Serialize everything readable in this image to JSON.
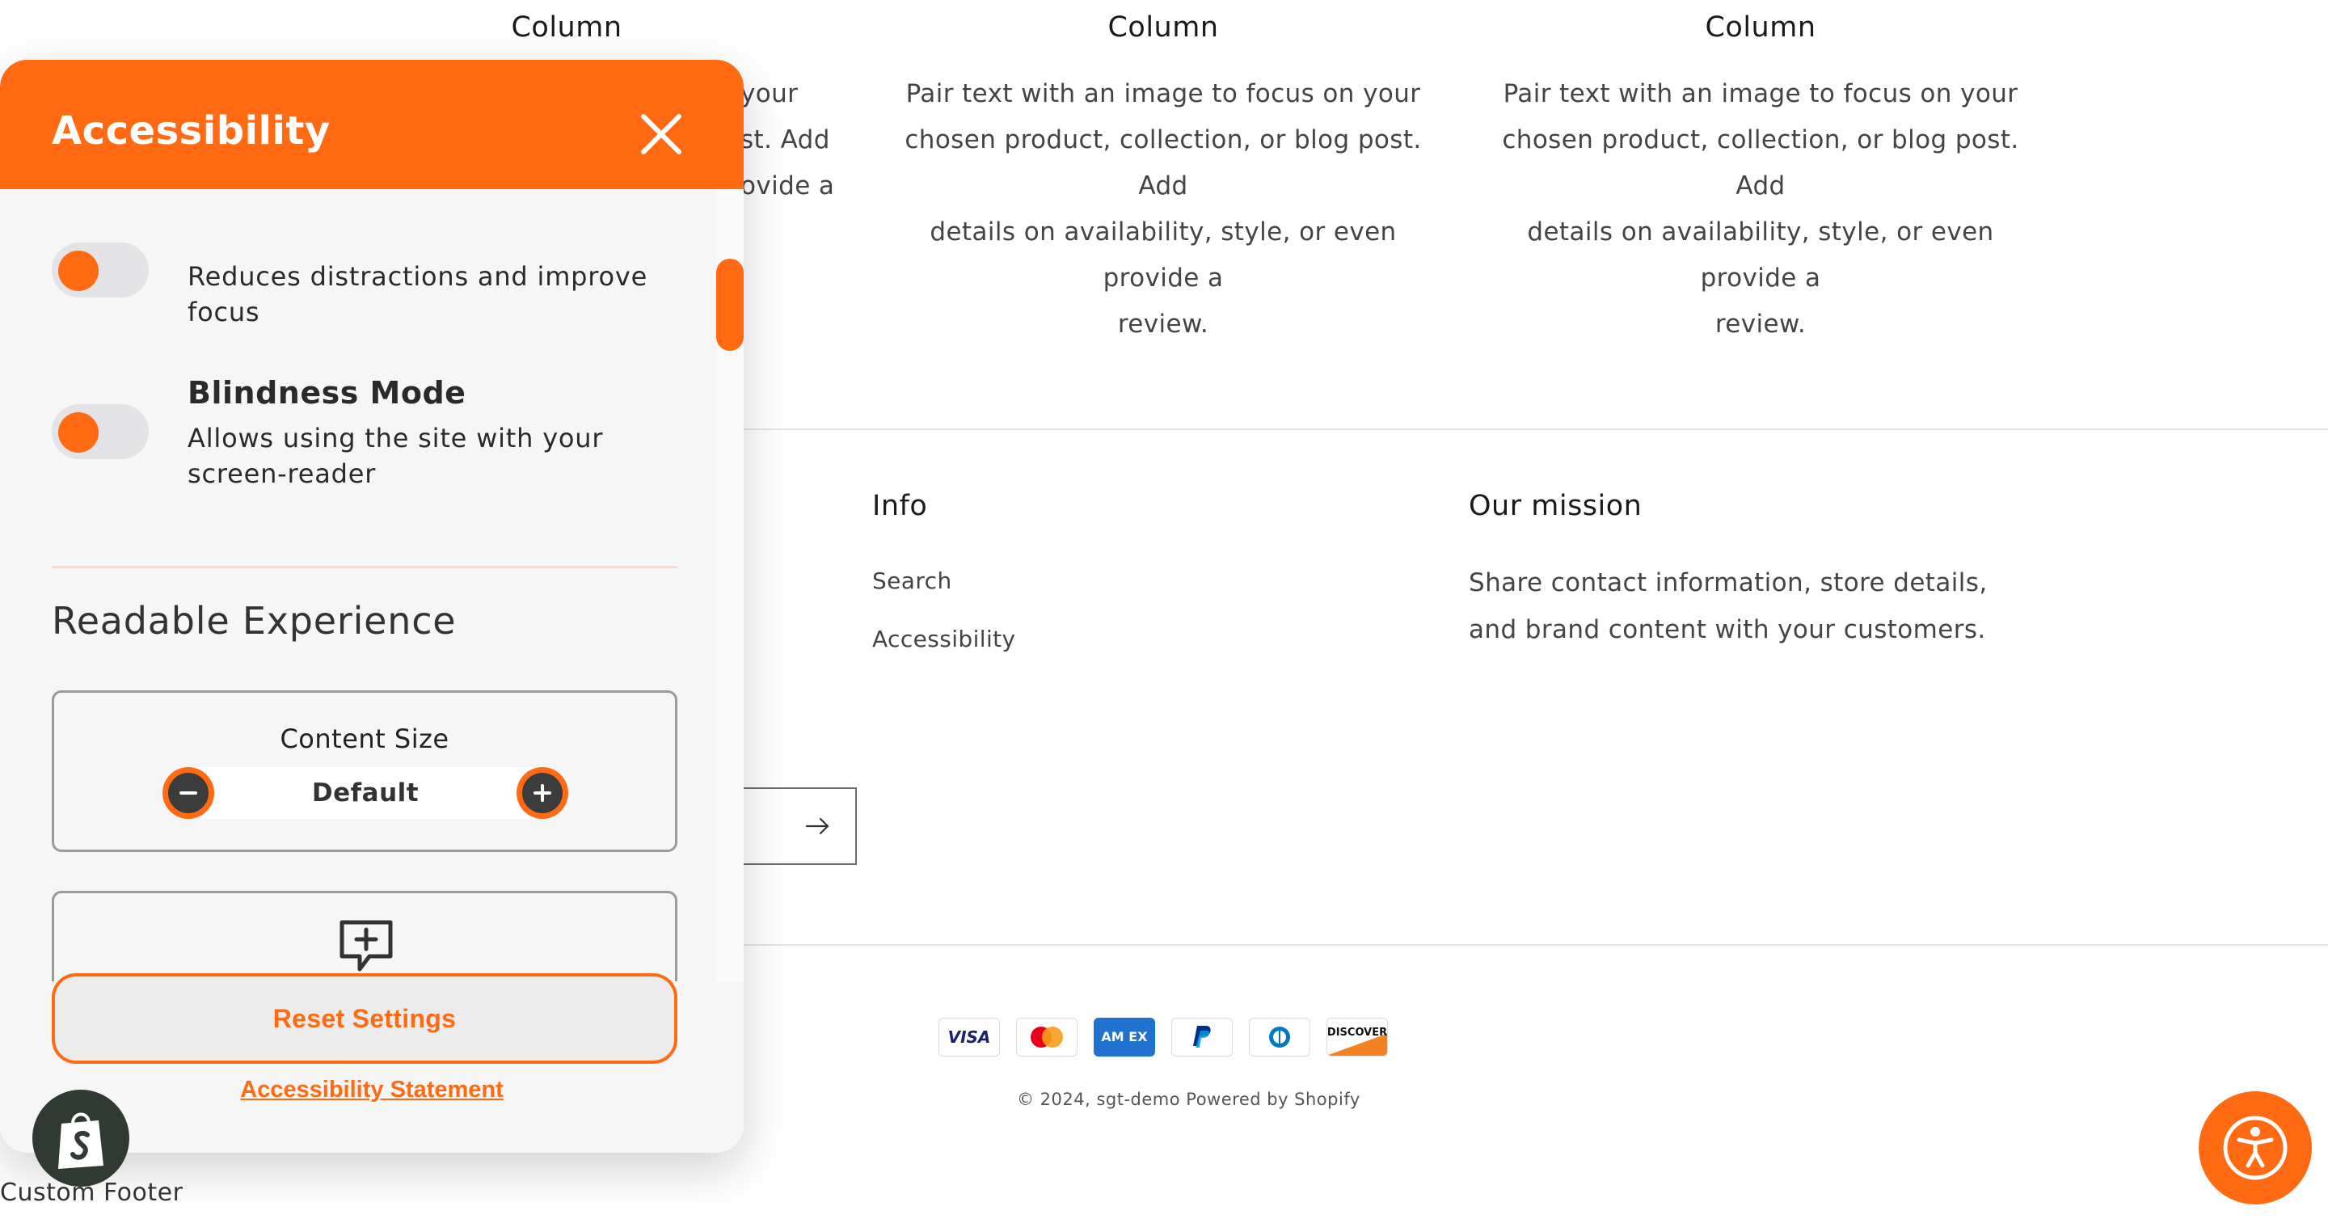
{
  "columns": [
    {
      "title": "Column",
      "text_fragment": [
        "your",
        "st. Add",
        "ovide a"
      ]
    },
    {
      "title": "Column",
      "text": [
        "Pair text with an image to focus on your",
        "chosen product, collection, or blog post. Add",
        "details on availability, style, or even provide a",
        "review."
      ]
    },
    {
      "title": "Column",
      "text": [
        "Pair text with an image to focus on your",
        "chosen product, collection, or blog post. Add",
        "details on availability, style, or even provide a",
        "review."
      ]
    }
  ],
  "footer": {
    "info": {
      "heading": "Info",
      "links": [
        "Search",
        "Accessibility"
      ]
    },
    "mission": {
      "heading": "Our mission",
      "text": "Share contact information, store details, and brand content with your customers."
    },
    "payment_icons": [
      "visa-icon",
      "mastercard-icon",
      "amex-icon",
      "paypal-icon",
      "diners-club-icon",
      "discover-icon"
    ],
    "payment_labels": {
      "visa": "VISA",
      "amex": "AM EX",
      "discover": "DISCOVER"
    },
    "copyright": "© 2024, sgt-demo Powered by Shopify",
    "custom_footer": "Custom Footer"
  },
  "accessibility_panel": {
    "title": "Accessibility",
    "features": [
      {
        "title": "",
        "description": "Reduces distractions and improve focus",
        "enabled": false
      },
      {
        "title": "Blindness Mode",
        "description": "Allows using the site with your screen-reader",
        "enabled": false
      }
    ],
    "section_title": "Readable Experience",
    "content_size": {
      "label": "Content Size",
      "value": "Default"
    },
    "reset_label": "Reset Settings",
    "statement_link": "Accessibility Statement"
  },
  "colors": {
    "accent": "#ff6a13",
    "panel_bg": "#f6f6f7",
    "toggle_track": "#e4e4e6"
  }
}
